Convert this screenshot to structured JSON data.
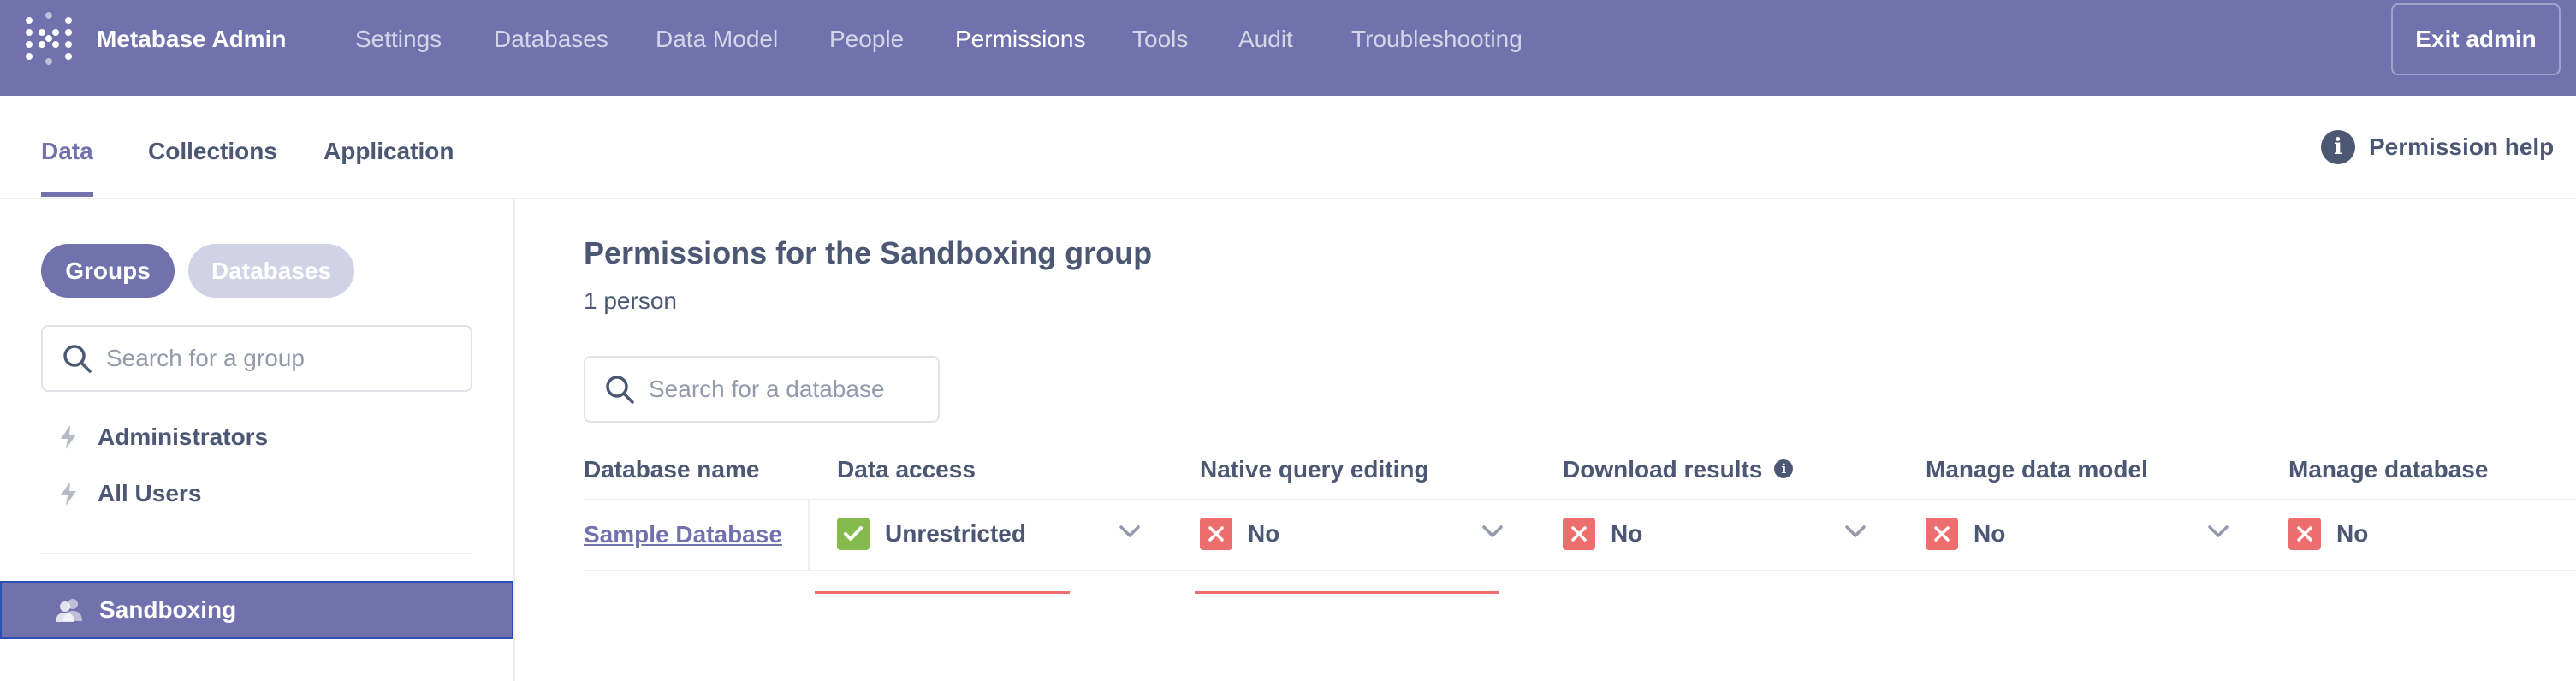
{
  "app": {
    "brand": "Metabase Admin",
    "nav": [
      "Settings",
      "Databases",
      "Data Model",
      "People",
      "Permissions",
      "Tools",
      "Audit",
      "Troubleshooting"
    ],
    "active_nav": "Permissions",
    "exit_label": "Exit admin"
  },
  "tabs": {
    "items": [
      "Data",
      "Collections",
      "Application"
    ],
    "active": "Data",
    "help_label": "Permission help"
  },
  "sidebar": {
    "toggle": {
      "groups": "Groups",
      "databases": "Databases",
      "active": "Groups"
    },
    "search_placeholder": "Search for a group",
    "pinned_groups": [
      "Administrators",
      "All Users"
    ],
    "groups": [
      "Sandboxing"
    ],
    "selected_group": "Sandboxing"
  },
  "main": {
    "title": "Permissions for the Sandboxing group",
    "member_count": "1 person",
    "search_placeholder": "Search for a database",
    "columns": [
      "Database name",
      "Data access",
      "Native query editing",
      "Download results",
      "Manage data model",
      "Manage database"
    ],
    "rows": [
      {
        "database": "Sample Database",
        "data_access": "Unrestricted",
        "native_query_editing": "No",
        "download_results": "No",
        "manage_data_model": "No",
        "manage_database": "No"
      }
    ]
  },
  "colors": {
    "brand": "#7172ad",
    "allow": "#84bb4c",
    "deny": "#ed6e6e",
    "text": "#4c5773"
  },
  "icons": [
    "metabase-logo-icon",
    "info-icon",
    "search-icon",
    "bolt-icon",
    "group-people-icon",
    "check-icon",
    "close-icon",
    "chevron-down-icon"
  ]
}
